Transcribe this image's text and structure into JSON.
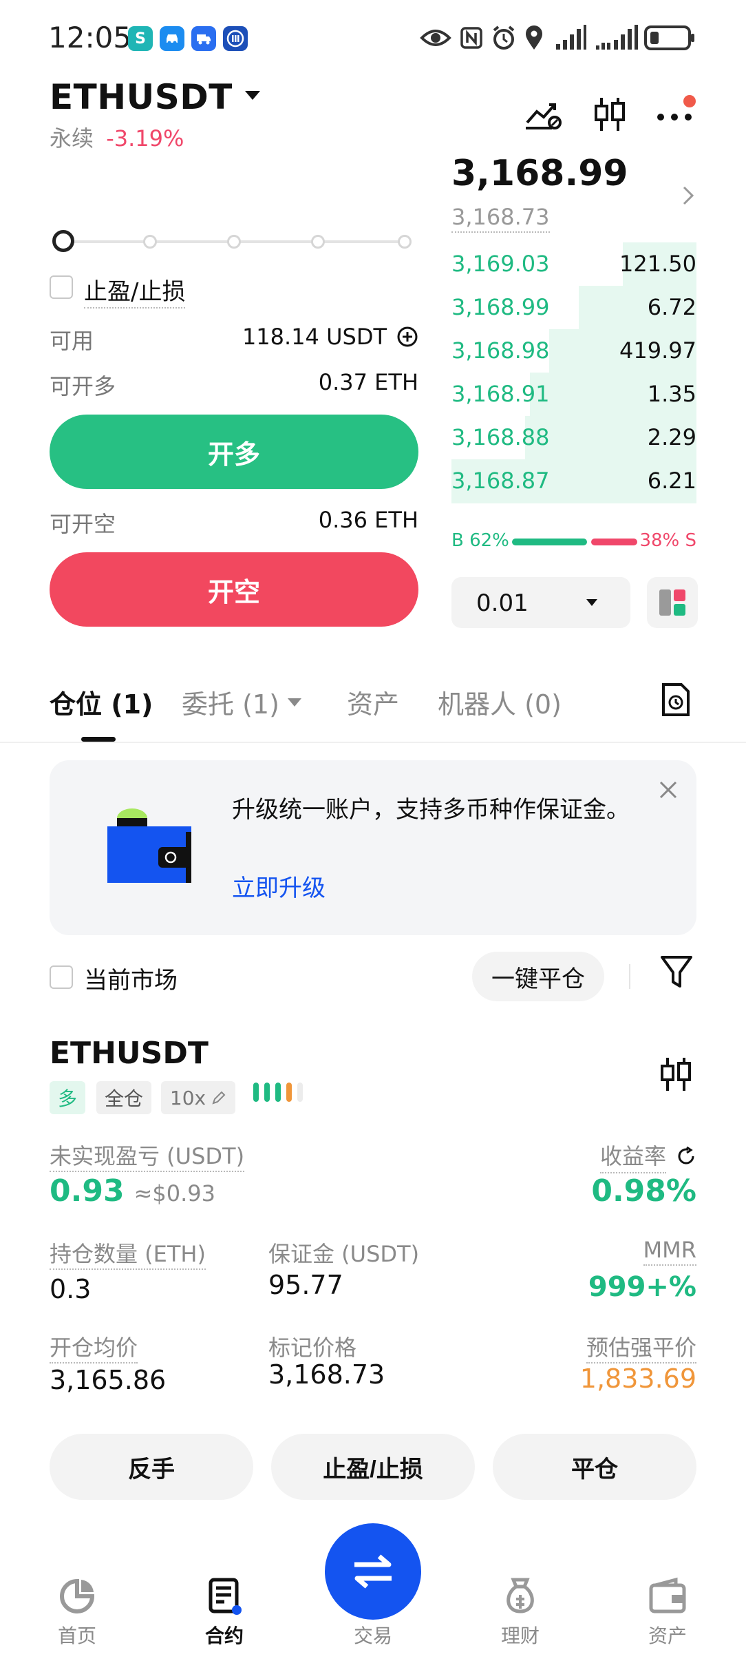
{
  "status_bar": {
    "time": "12:05",
    "app_icons": [
      "s-app-icon",
      "car-app-icon",
      "truck-app-icon",
      "bank-app-icon"
    ],
    "system_icons": [
      "eye-icon",
      "nfc-icon",
      "alarm-icon",
      "location-icon",
      "signal-icon",
      "signal-icon",
      "battery-icon"
    ]
  },
  "header": {
    "symbol": "ETHUSDT",
    "contract_type": "永续",
    "change_pct": "-3.19%"
  },
  "trade_form": {
    "tp_sl_label": "止盈/止损",
    "available_label": "可用",
    "available_value": "118.14 USDT",
    "max_long_label": "可开多",
    "max_long_value": "0.37 ETH",
    "long_button": "开多",
    "max_short_label": "可开空",
    "max_short_value": "0.36 ETH",
    "short_button": "开空"
  },
  "order_book": {
    "last_price": "3,168.99",
    "mark_price": "3,168.73",
    "bids": [
      {
        "price": "3,169.03",
        "size": "121.50",
        "depth": 0.3
      },
      {
        "price": "3,168.99",
        "size": "6.72",
        "depth": 0.48
      },
      {
        "price": "3,168.98",
        "size": "419.97",
        "depth": 0.6
      },
      {
        "price": "3,168.91",
        "size": "1.35",
        "depth": 0.68
      },
      {
        "price": "3,168.88",
        "size": "2.29",
        "depth": 0.7
      },
      {
        "price": "3,168.87",
        "size": "6.21",
        "depth": 1.0
      }
    ],
    "buy_ratio_label": "B 62%",
    "sell_ratio_label": "38% S",
    "buy_ratio": 0.62,
    "precision": "0.01"
  },
  "tabs": [
    {
      "label": "仓位 (1)"
    },
    {
      "label": "委托 (1)"
    },
    {
      "label": "资产"
    },
    {
      "label": "机器人 (0)"
    }
  ],
  "banner": {
    "text": "升级统一账户，支持多币种作保证金。",
    "link": "立即升级"
  },
  "filter_bar": {
    "current_market": "当前市场",
    "close_all": "一键平仓"
  },
  "position": {
    "symbol": "ETHUSDT",
    "side_tag": "多",
    "margin_mode_tag": "全仓",
    "leverage_tag": "10x",
    "unrealized_pnl_label": "未实现盈亏 (USDT)",
    "unrealized_pnl": "0.93",
    "unrealized_pnl_usd": "≈$0.93",
    "roe_label": "收益率",
    "roe": "0.98%",
    "qty_label": "持仓数量 (ETH)",
    "qty": "0.3",
    "margin_label": "保证金 (USDT)",
    "margin": "95.77",
    "mmr_label": "MMR",
    "mmr": "999+%",
    "entry_label": "开仓均价",
    "entry": "3,165.86",
    "mark_label": "标记价格",
    "mark": "3,168.73",
    "liq_label": "预估强平价",
    "liq": "1,833.69",
    "reverse_button": "反手",
    "tpsl_button": "止盈/止损",
    "close_button": "平仓"
  },
  "colors": {
    "green": "#1fba82",
    "red": "#f0476a",
    "orange": "#f0963a",
    "blue": "#1454f0"
  },
  "bottom_nav": [
    {
      "label": "首页",
      "icon": "home-icon"
    },
    {
      "label": "合约",
      "icon": "contract-icon"
    },
    {
      "label": "交易",
      "icon": "swap-icon"
    },
    {
      "label": "理财",
      "icon": "finance-icon"
    },
    {
      "label": "资产",
      "icon": "wallet-icon"
    }
  ]
}
